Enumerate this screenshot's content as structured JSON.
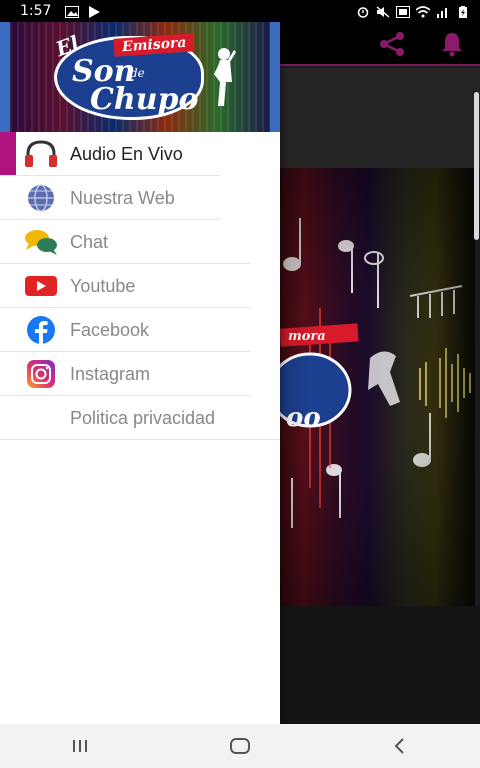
{
  "status_bar": {
    "time": "1:57",
    "icons": [
      "image-icon",
      "play-icon",
      "alarm-icon",
      "mute-icon",
      "volte-icon",
      "wifi-icon",
      "signal-icon",
      "battery-icon"
    ]
  },
  "header": {
    "logo": {
      "line1": "El",
      "line2": "Son",
      "line3": "de",
      "line4": "Chupo",
      "badge": "Emisora"
    }
  },
  "menu": {
    "items": [
      {
        "label": "Audio En Vivo",
        "icon": "headphones-icon",
        "active": true
      },
      {
        "label": "Nuestra Web",
        "icon": "globe-icon",
        "active": false
      },
      {
        "label": "Chat",
        "icon": "chat-icon",
        "active": false
      },
      {
        "label": "Youtube",
        "icon": "youtube-icon",
        "active": false
      },
      {
        "label": "Facebook",
        "icon": "facebook-icon",
        "active": false
      },
      {
        "label": "Instagram",
        "icon": "instagram-icon",
        "active": false
      },
      {
        "label": "Politica privacidad",
        "icon": "",
        "active": false
      }
    ]
  },
  "toolbar": {
    "actions": [
      "share-icon",
      "notification-bell-icon"
    ]
  },
  "colors": {
    "accent": "#b0137f",
    "toolbar_icon": "#8a1a6a",
    "drawer_bg": "#ffffff",
    "header_border": "#3a6dbf"
  },
  "nav_bar": {
    "buttons": [
      "recent-apps-icon",
      "home-icon",
      "back-icon"
    ]
  }
}
